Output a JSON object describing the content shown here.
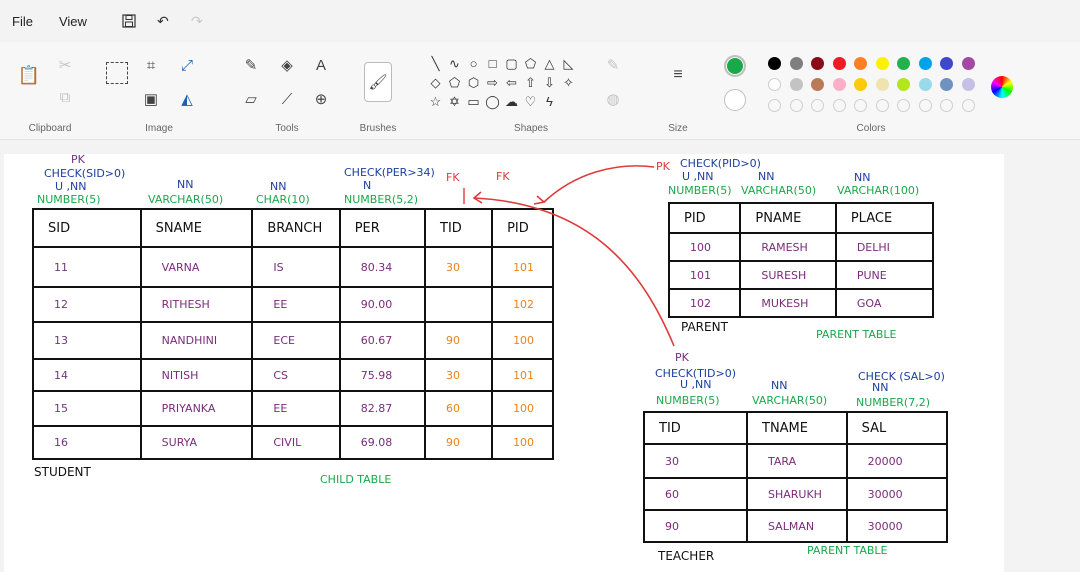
{
  "menubar": {
    "file": "File",
    "view": "View"
  },
  "ribbon": {
    "groups": {
      "clipboard": "Clipboard",
      "image": "Image",
      "tools": "Tools",
      "brushes": "Brushes",
      "shapes": "Shapes",
      "size": "Size",
      "colors": "Colors"
    },
    "colors": {
      "primary": "#1aa84a",
      "secondary": "#ffffff",
      "palette_row1": [
        "#000000",
        "#7f7f7f",
        "#8b0c18",
        "#ec1c24",
        "#ff7f27",
        "#fff200",
        "#22b14c",
        "#00a2e8",
        "#3f48cc",
        "#a349a4"
      ],
      "palette_row2": [
        "#ffffff",
        "#c3c3c3",
        "#b97a57",
        "#ffaec9",
        "#ffc90e",
        "#efe4b0",
        "#b5e61d",
        "#99d9ea",
        "#7092be",
        "#c8bfe7"
      ]
    }
  },
  "student": {
    "constraints": {
      "sid": [
        "PK",
        "CHECK(SID>0)",
        "U ,NN",
        "NUMBER(5)"
      ],
      "sname": [
        "NN",
        "VARCHAR(50)"
      ],
      "branch": [
        "NN",
        "CHAR(10)"
      ],
      "per": [
        "CHECK(PER>34)",
        "N",
        "NUMBER(5,2)"
      ],
      "tid_fk": "FK",
      "pid_fk": "FK"
    },
    "headers": [
      "SID",
      "SNAME",
      "BRANCH",
      "PER",
      "TID",
      "PID"
    ],
    "rows": [
      [
        "11",
        "VARNA",
        "IS",
        "80.34",
        "30",
        "101"
      ],
      [
        "12",
        "RITHESH",
        "EE",
        "90.00",
        "",
        "102"
      ],
      [
        "13",
        "NANDHINI",
        "ECE",
        "60.67",
        "90",
        "100"
      ],
      [
        "14",
        "NITISH",
        "CS",
        "75.98",
        "30",
        "101"
      ],
      [
        "15",
        "PRIYANKA",
        "EE",
        "82.87",
        "60",
        "100"
      ],
      [
        "16",
        "SURYA",
        "CIVIL",
        "69.08",
        "90",
        "100"
      ]
    ],
    "name": "STUDENT",
    "caption": "CHILD TABLE"
  },
  "parent": {
    "pk_label": "PK",
    "constraints": {
      "pid": [
        "CHECK(PID>0)",
        "U ,NN",
        "NUMBER(5)"
      ],
      "pname": [
        "NN",
        "VARCHAR(50)"
      ],
      "place": [
        "NN",
        "VARCHAR(100)"
      ]
    },
    "headers": [
      "PID",
      "PNAME",
      "PLACE"
    ],
    "rows": [
      [
        "100",
        "RAMESH",
        "DELHI"
      ],
      [
        "101",
        "SURESH",
        "PUNE"
      ],
      [
        "102",
        "MUKESH",
        "GOA"
      ]
    ],
    "name": "PARENT",
    "caption": "PARENT TABLE"
  },
  "teacher": {
    "constraints": {
      "tid": [
        "PK",
        "CHECK(TID>0)",
        "U ,NN",
        "NUMBER(5)"
      ],
      "tname": [
        "NN",
        "VARCHAR(50)"
      ],
      "sal": [
        "CHECK (SAL>0)",
        "NN",
        "NUMBER(7,2)"
      ]
    },
    "headers": [
      "TID",
      "TNAME",
      "SAL"
    ],
    "rows": [
      [
        "30",
        "TARA",
        "20000"
      ],
      [
        "60",
        "SHARUKH",
        "30000"
      ],
      [
        "90",
        "SALMAN",
        "30000"
      ]
    ],
    "name": "TEACHER",
    "caption": "PARENT TABLE"
  }
}
